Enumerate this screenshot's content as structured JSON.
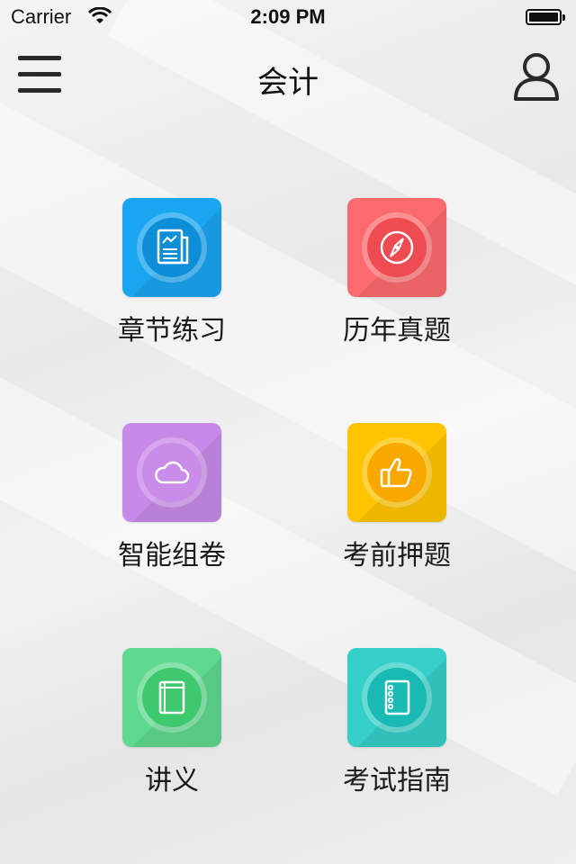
{
  "status_bar": {
    "carrier": "Carrier",
    "time": "2:09 PM"
  },
  "nav": {
    "title": "会计",
    "menu_icon": "hamburger-menu-icon",
    "user_icon": "user-profile-icon"
  },
  "tiles": [
    {
      "label": "章节练习",
      "icon": "newspaper-icon",
      "color": "#1aa5f0"
    },
    {
      "label": "历年真题",
      "icon": "compass-icon",
      "color": "#fb6b6e"
    },
    {
      "label": "智能组卷",
      "icon": "cloud-icon",
      "color": "#c88ae8"
    },
    {
      "label": "考前押题",
      "icon": "thumbs-up-icon",
      "color": "#ffc400"
    },
    {
      "label": "讲义",
      "icon": "book-icon",
      "color": "#5fd98f"
    },
    {
      "label": "考试指南",
      "icon": "notebook-icon",
      "color": "#35cfc8"
    }
  ]
}
